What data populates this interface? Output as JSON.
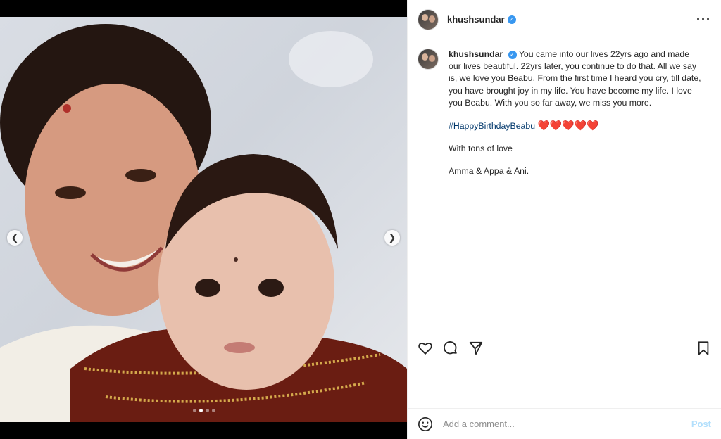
{
  "post": {
    "username": "khushsundar",
    "more_icon": "more-horizontal-icon",
    "carousel": {
      "total": 4,
      "active_index": 1,
      "prev_icon": "chevron-left-icon",
      "next_icon": "chevron-right-icon"
    }
  },
  "caption": {
    "username": "khushsundar",
    "body": "You came into our lives 22yrs ago and made our lives beautiful. 22yrs later, you continue to do that. All we say is, we love you Beabu. From the first time I heard you cry, till date, you have brought joy in my life. You have become my life. I love you Beabu. With you so far away, we miss you more.",
    "hashtag": "#HappyBirthdayBeabu",
    "hearts": "❤️❤️❤️❤️❤️",
    "line2": "With tons of love",
    "line3": "Amma & Appa & Ani."
  },
  "actions": [
    "heart-icon",
    "comment-icon",
    "share-icon",
    "bookmark-icon"
  ],
  "comment": {
    "placeholder": "Add a comment...",
    "post_label": "Post",
    "emoji_icon": "emoji-icon"
  },
  "colors": {
    "link": "#00376b",
    "verified": "#3897f0",
    "post_button": "#b2dffc",
    "heart": "#ed4956"
  }
}
